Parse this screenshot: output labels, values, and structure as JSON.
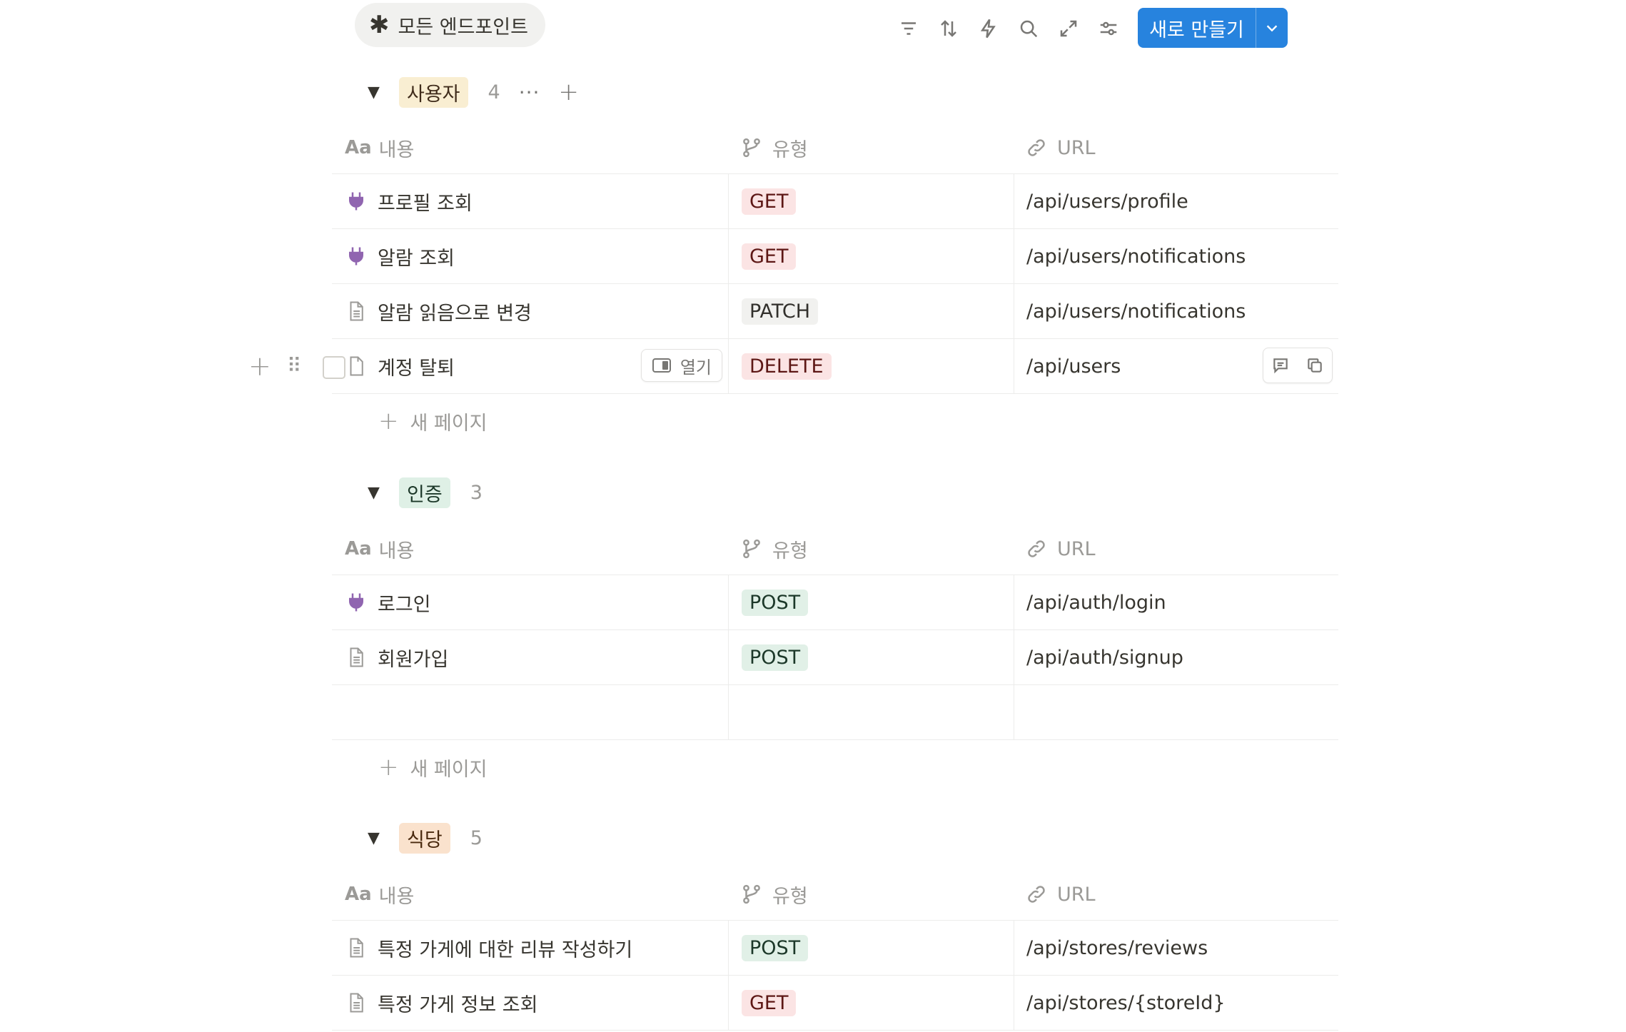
{
  "view_tab": {
    "label": "모든 엔드포인트",
    "icon": "asterisk-icon"
  },
  "toolbar": {
    "icons": [
      "filter-icon",
      "sort-icon",
      "automation-icon",
      "search-icon",
      "expand-icon",
      "settings-icon"
    ],
    "new_button_label": "새로 만들기"
  },
  "columns": {
    "name": "내용",
    "name_prefix": "Aa",
    "type": "유형",
    "url": "URL"
  },
  "new_page_label": "새 페이지",
  "open_label": "열기",
  "colors": {
    "accent": "#2783de",
    "get": "#fbe4e4",
    "post": "#e1f0e7",
    "patch": "#f1f1ef",
    "delete": "#fbe4e4",
    "tag_users": "#f9eed2",
    "tag_auth": "#dff0e6",
    "tag_store": "#fae2cd",
    "api_icon": "#9065b0"
  },
  "groups": [
    {
      "tag": "사용자",
      "count": "4",
      "rows": [
        {
          "icon": "plug-icon",
          "name": "프로필 조회",
          "method": "GET",
          "url": "/api/users/profile"
        },
        {
          "icon": "plug-icon",
          "name": "알람 조회",
          "method": "GET",
          "url": "/api/users/notifications"
        },
        {
          "icon": "document-icon",
          "name": "알람 읽음으로 변경",
          "method": "PATCH",
          "url": "/api/users/notifications"
        },
        {
          "icon": "document-icon",
          "name": "계정 탈퇴",
          "method": "DELETE",
          "url": "/api/users"
        }
      ]
    },
    {
      "tag": "인증",
      "count": "3",
      "rows": [
        {
          "icon": "plug-icon",
          "name": "로그인",
          "method": "POST",
          "url": "/api/auth/login"
        },
        {
          "icon": "document-icon",
          "name": "회원가입",
          "method": "POST",
          "url": "/api/auth/signup"
        },
        {
          "icon": "",
          "name": "",
          "method": "",
          "url": ""
        }
      ]
    },
    {
      "tag": "식당",
      "count": "5",
      "rows": [
        {
          "icon": "document-icon",
          "name": "특정 가게에 대한 리뷰 작성하기",
          "method": "POST",
          "url": "/api/stores/reviews"
        },
        {
          "icon": "document-icon",
          "name": "특정 가게 정보 조회",
          "method": "GET",
          "url": "/api/stores/{storeId}"
        }
      ]
    }
  ]
}
